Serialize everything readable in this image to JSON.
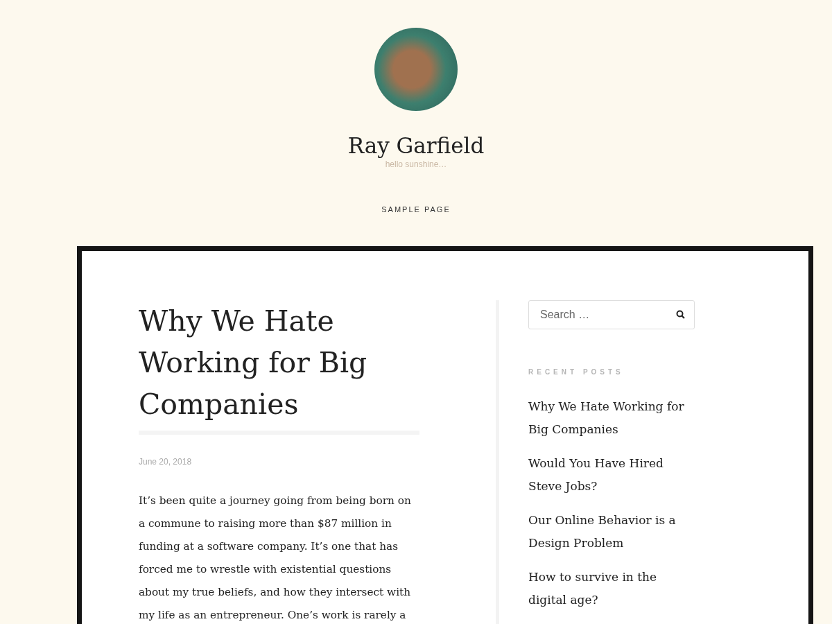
{
  "site": {
    "title": "Ray Garfield",
    "tagline": "hello sunshine…"
  },
  "nav": [
    {
      "label": "SAMPLE PAGE"
    }
  ],
  "post": {
    "title": "Why We Hate Working for Big Companies",
    "date": "June 20, 2018",
    "body": "It’s been quite a journey going from being born on a commune to raising more than $87 million in funding at a software company. It’s one that has forced me to wrestle with existential questions about my true beliefs, and how they intersect with my life as an entrepreneur. One’s work is rarely a"
  },
  "sidebar": {
    "search": {
      "placeholder": "Search …"
    },
    "recent_posts": {
      "heading": "RECENT POSTS",
      "items": [
        {
          "label": "Why We Hate Working for Big Companies"
        },
        {
          "label": "Would You Have Hired Steve Jobs?"
        },
        {
          "label": "Our Online Behavior is a Design Problem"
        },
        {
          "label": "How to survive in the digital age?"
        }
      ]
    }
  }
}
